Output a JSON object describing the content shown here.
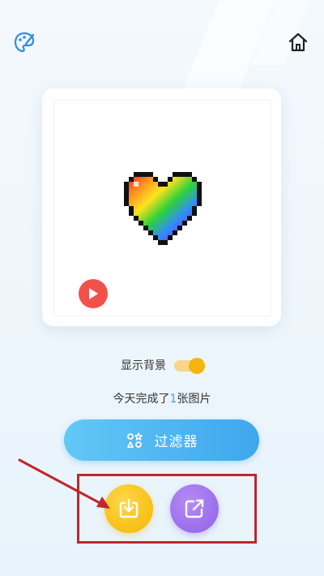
{
  "header": {
    "left_icon": "palette-icon",
    "right_icon": "home-icon"
  },
  "artwork": {
    "subject": "rainbow pixel heart",
    "play_icon": "play-icon"
  },
  "settings": {
    "show_background_label": "显示背景",
    "show_background_on": true
  },
  "status": {
    "completed_prefix": "今天完成了",
    "completed_count": "1",
    "completed_suffix": "张图片"
  },
  "filter_button": {
    "label": "过滤器",
    "icon": "filter-icon"
  },
  "actions": {
    "download_icon": "download-icon",
    "share_icon": "share-icon"
  },
  "colors": {
    "accent_blue": "#3fa6ee",
    "toggle_yellow": "#f6b40d",
    "download_yellow": "#f4b400",
    "share_purple": "#8e62e8",
    "play_red": "#f2504a",
    "annotation_red": "#c0272d"
  }
}
